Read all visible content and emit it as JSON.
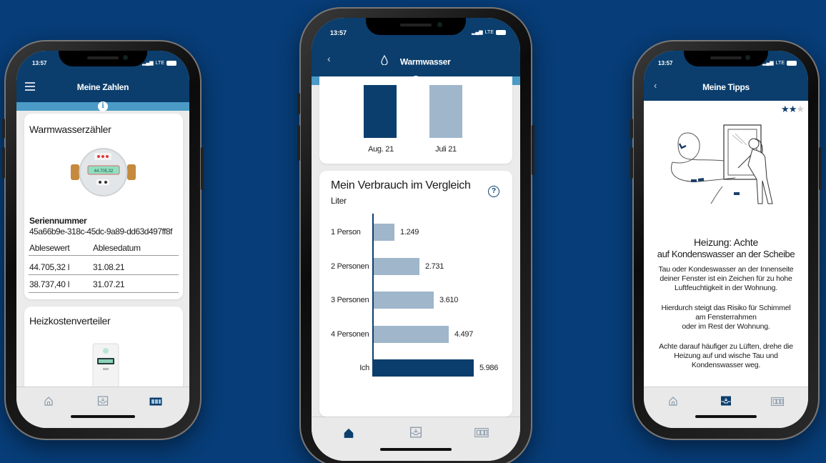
{
  "colors": {
    "background": "#073d78",
    "header": "#0b3e6d",
    "accent": "#4b9bc6",
    "bar_dark": "#0b3e6d",
    "bar_light": "#9fb6cb"
  },
  "phone1": {
    "status_time": "13:57",
    "network": "LTE",
    "nav": {
      "menu_icon": "hamburger-icon",
      "title": "Meine Zahlen"
    },
    "info_icon": "info-icon",
    "meter_card": {
      "title": "Warmwasserzähler",
      "meter_image_icon": "water-meter-icon",
      "meter_display": "44.705,32",
      "serial_label": "Seriennummer",
      "serial_value": "45a66b9e-318c-45dc-9a89-dd63d497ff8f",
      "table": {
        "headers": [
          "Ablesewert",
          "Ablesedatum"
        ],
        "rows": [
          [
            "44.705,32 l",
            "31.08.21"
          ],
          [
            "38.737,40 l",
            "31.07.21"
          ]
        ]
      }
    },
    "heat_card": {
      "title": "Heizkostenverteiler",
      "image_icon": "heat-cost-allocator-icon"
    },
    "tabbar": [
      "home-icon",
      "inbox-icon",
      "meter-icon"
    ],
    "active_tab": 2
  },
  "phone2": {
    "status_time": "13:57",
    "network": "LTE",
    "nav": {
      "back_icon": "chevron-left-icon",
      "title_icon": "water-drop-icon",
      "title": "Warmwasser"
    },
    "info_icon": "info-icon",
    "top_chart": {
      "categories": [
        "Aug. 21",
        "Juli 21"
      ]
    },
    "compare_card": {
      "title": "Mein Verbrauch im Vergleich",
      "unit": "Liter",
      "help_icon": "question-icon"
    },
    "chart_data": [
      {
        "type": "bar",
        "categories": [
          "Aug. 21",
          "Juli 21"
        ],
        "values": [
          null,
          null
        ],
        "note_colors": [
          "#0b3e6d",
          "#9fb6cb"
        ]
      },
      {
        "type": "bar",
        "orientation": "horizontal",
        "title": "Mein Verbrauch im Vergleich",
        "ylabel": "Liter",
        "categories": [
          "1 Person",
          "2 Personen",
          "3 Personen",
          "4 Personen",
          "Ich"
        ],
        "values": [
          1249,
          2731,
          3610,
          4497,
          5986
        ],
        "value_labels": [
          "1.249",
          "2.731",
          "3.610",
          "4.497",
          "5.986"
        ],
        "xlim": [
          0,
          5986
        ],
        "highlight_category": "Ich"
      }
    ],
    "tabbar": [
      "home-icon",
      "inbox-icon",
      "meter-icon"
    ],
    "active_tab": 0
  },
  "phone3": {
    "status_time": "13:57",
    "network": "LTE",
    "nav": {
      "back_icon": "chevron-left-icon",
      "title": "Meine Tipps"
    },
    "rating": {
      "value": 2,
      "max": 3
    },
    "illustration_icon": "window-ventilation-illustration",
    "tip": {
      "title_line1": "Heizung: Achte",
      "title_line2": "auf Kondenswasser an der Scheibe",
      "p1": "Tau oder Kondeswasser an der Innenseite deiner Fenster ist ein Zeichen für zu hohe Luftfeuchtigkeit in der Wohnung.",
      "p2_line1": "Hierdurch steigt das Risiko für Schimmel",
      "p2_line2": "am Fensterrahmen",
      "p2_line3": "oder im Rest der Wohnung.",
      "p3": "Achte darauf häufiger zu Lüften, drehe die Heizung auf und wische Tau und Kondenswasser weg."
    },
    "tabbar": [
      "home-icon",
      "inbox-icon",
      "meter-icon"
    ],
    "active_tab": 1
  }
}
